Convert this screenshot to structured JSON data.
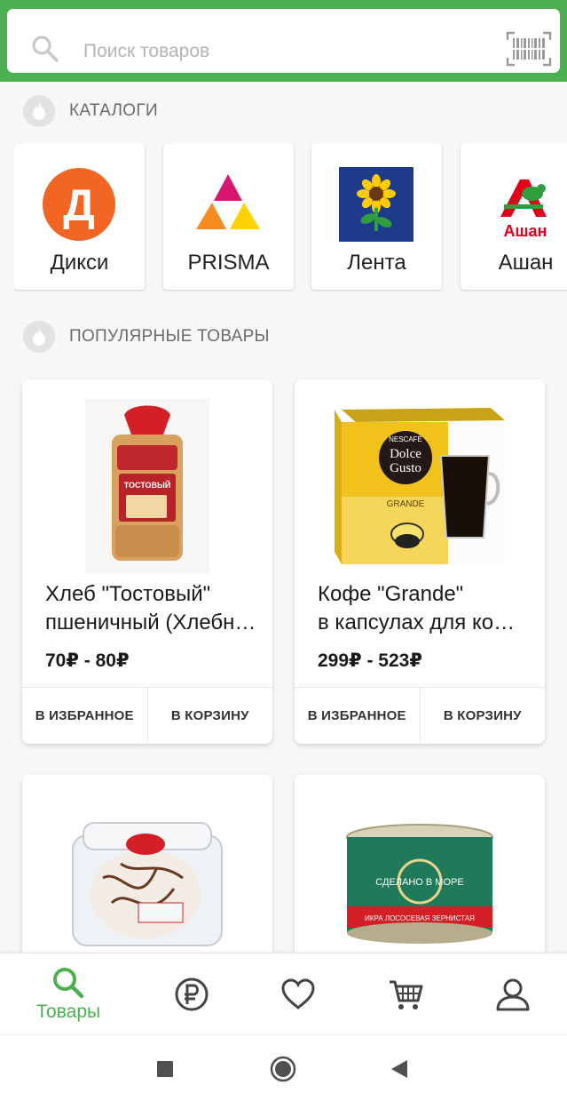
{
  "search": {
    "placeholder": "Поиск товаров",
    "icon": "search-icon",
    "scanner_icon": "barcode-icon"
  },
  "sections": {
    "catalogs_title": "КАТАЛОГИ",
    "popular_title": "ПОПУЛЯРНЫЕ ТОВАРЫ"
  },
  "catalogs": [
    {
      "name": "Дикси",
      "logo_letter": "Д",
      "logo": "diksi-logo"
    },
    {
      "name": "PRISMA",
      "logo": "prisma-logo"
    },
    {
      "name": "Лента",
      "logo": "lenta-logo"
    },
    {
      "name": "Ашан",
      "logo": "auchan-logo",
      "logo_text": "Ашан"
    }
  ],
  "products": [
    {
      "title_line1": "Хлеб \"Тостовый\"",
      "title_line2": "пшеничный (Хлебный Дом)",
      "price": "70₽ - 80₽",
      "favorite_label": "В ИЗБРАННОЕ",
      "cart_label": "В КОРЗИНУ",
      "image": "bread-image",
      "package_label": "ТОСТОВЫЙ"
    },
    {
      "title_line1": "Кофе \"Grande\"",
      "title_line2": "в капсулах для кофемашины",
      "price": "299₽ - 523₽",
      "favorite_label": "В ИЗБРАННОЕ",
      "cart_label": "В КОРЗИНУ",
      "image": "coffee-image",
      "package_brand": "NESCAFÉ",
      "package_line1": "Dolce",
      "package_line2": "Gusto",
      "package_variant": "GRANDE"
    },
    {
      "image": "cake-image"
    },
    {
      "image": "caviar-image",
      "package_line1": "СДЕЛАНО В МОРЕ",
      "package_line2": "ИКРА ЛОСОСЕВАЯ ЗЕРНИСТАЯ"
    }
  ],
  "bottom_nav": {
    "items": [
      {
        "label": "Товары",
        "icon": "search-icon",
        "active": true
      },
      {
        "label": "",
        "icon": "ruble-icon"
      },
      {
        "label": "",
        "icon": "heart-icon"
      },
      {
        "label": "",
        "icon": "cart-icon"
      },
      {
        "label": "",
        "icon": "profile-icon"
      }
    ]
  },
  "colors": {
    "accent": "#4caf50",
    "diksi": "#f26522",
    "lenta": "#1e3a8a",
    "auchan": "#e2001a"
  }
}
